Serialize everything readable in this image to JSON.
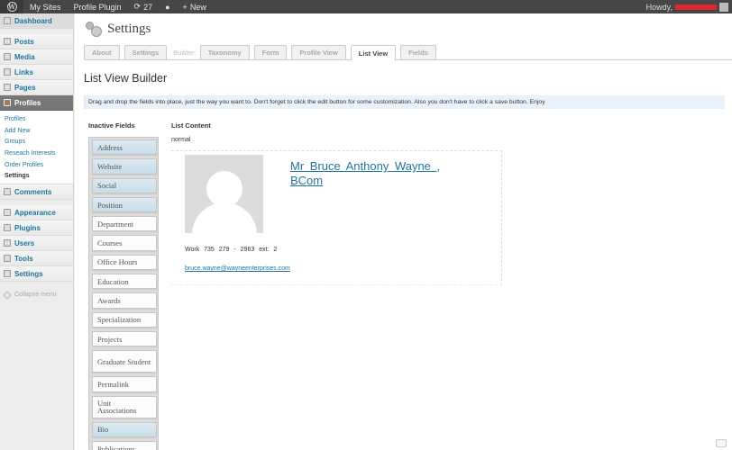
{
  "adminbar": {
    "my_sites": "My Sites",
    "site_name": "Profile Plugin",
    "updates_count": "27",
    "new_label": "New",
    "howdy": "Howdy,"
  },
  "sidebar": {
    "items": [
      {
        "label": "Dashboard",
        "icon": "dashboard-icon"
      },
      {
        "label": "Posts",
        "icon": "pin-icon"
      },
      {
        "label": "Media",
        "icon": "media-icon"
      },
      {
        "label": "Links",
        "icon": "link-icon"
      },
      {
        "label": "Pages",
        "icon": "page-icon"
      },
      {
        "label": "Profiles",
        "icon": "profile-icon"
      },
      {
        "label": "Comments",
        "icon": "comment-icon"
      },
      {
        "label": "Appearance",
        "icon": "appearance-icon"
      },
      {
        "label": "Plugins",
        "icon": "plugin-icon"
      },
      {
        "label": "Users",
        "icon": "users-icon"
      },
      {
        "label": "Tools",
        "icon": "tools-icon"
      },
      {
        "label": "Settings",
        "icon": "settings-icon"
      }
    ],
    "submenu": [
      "Profiles",
      "Add New",
      "Groups",
      "Reseach Interests",
      "Order Profiles",
      "Settings"
    ],
    "collapse": "Collapse menu"
  },
  "header": {
    "title": "Settings"
  },
  "tabs": {
    "about": "About",
    "settings": "Settings",
    "builder_label": "Builder:",
    "taxonomy": "Taxonomy",
    "form": "Form",
    "profile_view": "Profile View",
    "list_view": "List View",
    "fields": "Fields"
  },
  "main": {
    "title": "List View Builder",
    "notice": "Drag and drop the fields into place, just the way you want to. Don't forget to click the edit button for some customization. Also you don't have to click a save button. Enjoy",
    "inactive_title": "Inactive Fields",
    "list_content_title": "List Content",
    "normal": "normal"
  },
  "inactive_fields": [
    "Address",
    "Website",
    "Social",
    "Position",
    "Department",
    "Courses",
    "Office Hours",
    "Education",
    "Awards",
    "Specialization",
    "Projects",
    "Graduate Student",
    "Permalink",
    "Unit Associations",
    "Bio",
    "Publications"
  ],
  "profile": {
    "name": "Mr Bruce Anthony Wayne , BCom",
    "phone": "Work 735 279 - 2963 ext: 2",
    "email": "bruce.wayne@wayneenterprises.com"
  },
  "colors": {
    "link": "#21759b",
    "adminbar": "#464646",
    "highlight_field": "#c9dde8",
    "notice_bg": "#e8f2fa"
  }
}
